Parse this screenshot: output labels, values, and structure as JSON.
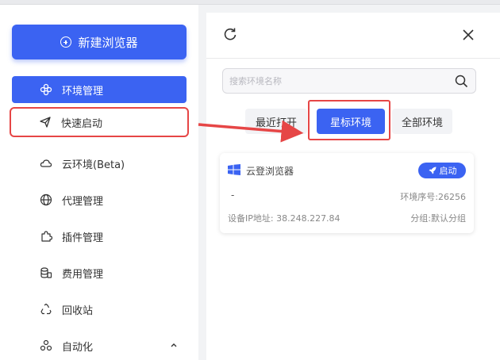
{
  "sidebar": {
    "new_button": "新建浏览器",
    "items": [
      {
        "label": "环境管理",
        "icon": "environment-icon"
      },
      {
        "label": "快速启动",
        "icon": "send-icon"
      },
      {
        "label": "云环境(Beta)",
        "icon": "cloud-icon"
      },
      {
        "label": "代理管理",
        "icon": "globe-icon"
      },
      {
        "label": "插件管理",
        "icon": "plugin-icon"
      },
      {
        "label": "费用管理",
        "icon": "billing-icon"
      },
      {
        "label": "回收站",
        "icon": "recycle-icon"
      },
      {
        "label": "自动化",
        "icon": "automation-icon"
      }
    ],
    "active_index": 0,
    "highlighted_index": 1
  },
  "panel": {
    "search_placeholder": "搜索环境名称",
    "tabs": [
      "最近打开",
      "星标环境",
      "全部环境"
    ],
    "active_tab": 1,
    "card": {
      "name": "云登浏览器",
      "launch_label": "启动",
      "dash": "-",
      "serial": "环境序号:26256",
      "ip": "设备IP地址: 38.248.227.84",
      "group": "分组:默认分组"
    }
  },
  "colors": {
    "accent": "#3b63f2",
    "highlight": "#e64646"
  }
}
